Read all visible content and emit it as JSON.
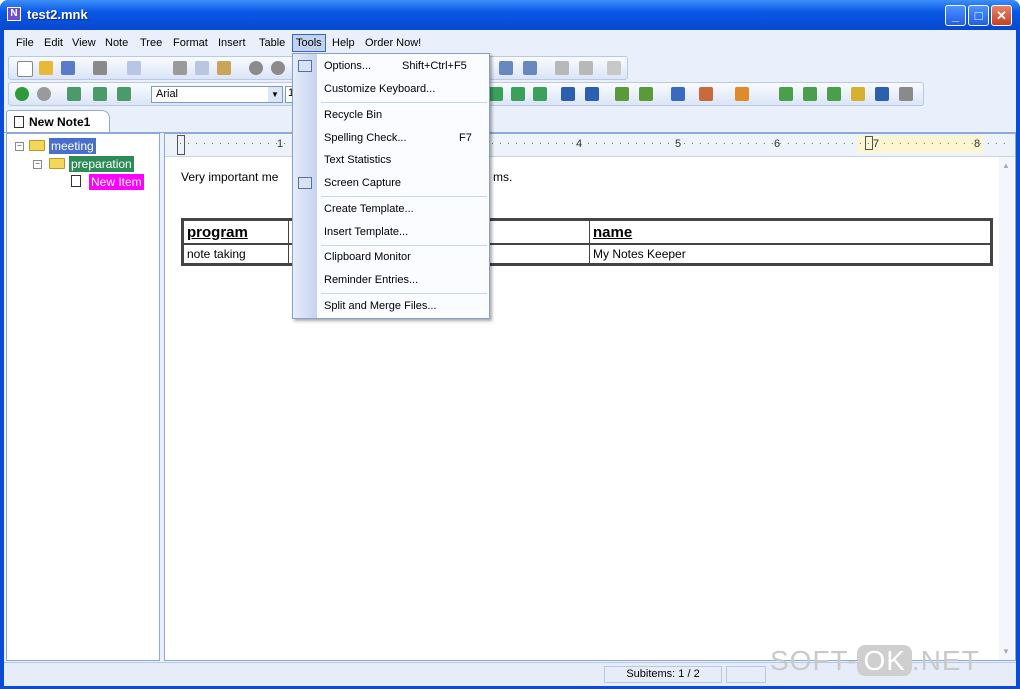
{
  "window": {
    "title": "test2.mnk"
  },
  "menu": [
    "File",
    "Edit",
    "View",
    "Note",
    "Tree",
    "Format",
    "Insert",
    "Table",
    "Tools",
    "Help",
    "Order Now!"
  ],
  "toolbar": {
    "font_name": "Arial",
    "font_size": "10"
  },
  "tab": {
    "label": "New Note1"
  },
  "tree": {
    "nodes": [
      {
        "label": "meeting",
        "bg": "#4a6fc8",
        "fg": "#ffffff"
      },
      {
        "label": "preparation",
        "bg": "#2e8b57",
        "fg": "#ffffff"
      },
      {
        "label": "New Item",
        "bg": "#ff00ff",
        "fg": "#ffffff"
      }
    ]
  },
  "ruler": {
    "numbers": [
      "1",
      "4",
      "5",
      "6",
      "7",
      "8"
    ]
  },
  "editor": {
    "text_left": "Very important me",
    "text_right": "ms.",
    "table": {
      "headers": [
        "program",
        "",
        "name"
      ],
      "rows": [
        [
          "note taking",
          "",
          "My Notes Keeper"
        ]
      ]
    }
  },
  "tools_menu": {
    "items": [
      {
        "label": "Options...",
        "shortcut": "Shift+Ctrl+F5"
      },
      {
        "label": "Customize Keyboard...",
        "shortcut": ""
      },
      {
        "label": "Recycle Bin",
        "shortcut": ""
      },
      {
        "label": "Spelling Check...",
        "shortcut": "F7"
      },
      {
        "label": "Text Statistics",
        "shortcut": ""
      },
      {
        "label": "Screen Capture",
        "shortcut": ""
      },
      {
        "label": "Create Template...",
        "shortcut": ""
      },
      {
        "label": "Insert Template...",
        "shortcut": ""
      },
      {
        "label": "Clipboard Monitor",
        "shortcut": ""
      },
      {
        "label": "Reminder Entries...",
        "shortcut": ""
      },
      {
        "label": "Split and Merge Files...",
        "shortcut": ""
      }
    ]
  },
  "status": {
    "subitems": "Subitems: 1 / 2"
  },
  "watermark": {
    "left": "SOFT-",
    "ok": "OK",
    "right": ".NET"
  }
}
